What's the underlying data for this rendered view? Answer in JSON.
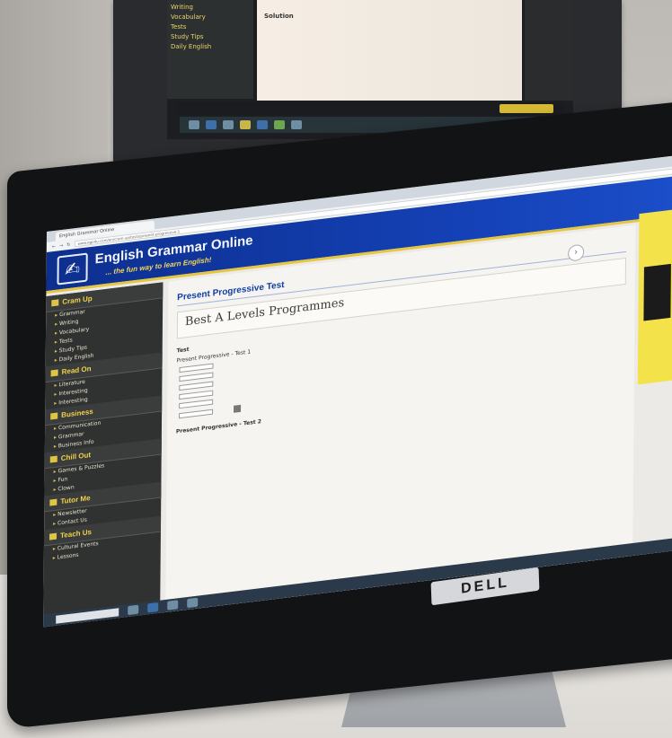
{
  "back_screen": {
    "nav_items": [
      "Writing",
      "Vocabulary",
      "Tests",
      "Study Tips",
      "Daily English"
    ],
    "solution_label": "Solution",
    "answers": [
      [
        "",
        ""
      ],
      [
        "",
        ""
      ],
      [
        "",
        ""
      ]
    ]
  },
  "browser": {
    "tab_label": "English Grammar Online",
    "url": "www.ego4u.com/en/cram-up/tests/present-progressive-1"
  },
  "site": {
    "title": "English Grammar Online",
    "tagline": "... the fun way to learn English!"
  },
  "nav": {
    "sections": [
      {
        "title": "Cram Up",
        "items": [
          "Grammar",
          "Writing",
          "Vocabulary",
          "Tests",
          "Study Tips",
          "Daily English"
        ]
      },
      {
        "title": "Read On",
        "items": [
          "Literature",
          "Interesting",
          "Interesting"
        ]
      },
      {
        "title": "Business",
        "items": [
          "Communication",
          "Grammar",
          "Business Info"
        ]
      },
      {
        "title": "Chill Out",
        "items": [
          "Games & Puzzles",
          "Fun",
          "Clown"
        ]
      },
      {
        "title": "Tutor Me",
        "items": [
          "Newsletter",
          "Contact Us"
        ]
      },
      {
        "title": "Teach Us",
        "items": [
          "Cultural Events",
          "Lessons"
        ]
      }
    ]
  },
  "content": {
    "breadcrumb": "",
    "page_title": "Present Progressive Test",
    "ad_title": "Best A Levels Programmes",
    "ad_subtitle": "",
    "intro": "",
    "test_heading": "Test",
    "exercise_heading": "Present Progressive - Test 1",
    "exercise_lines": [
      "",
      "",
      "",
      "",
      "",
      "",
      ""
    ],
    "exercise2_heading": "Present Progressive - Test 2"
  },
  "monitor": {
    "brand": "DELL"
  }
}
